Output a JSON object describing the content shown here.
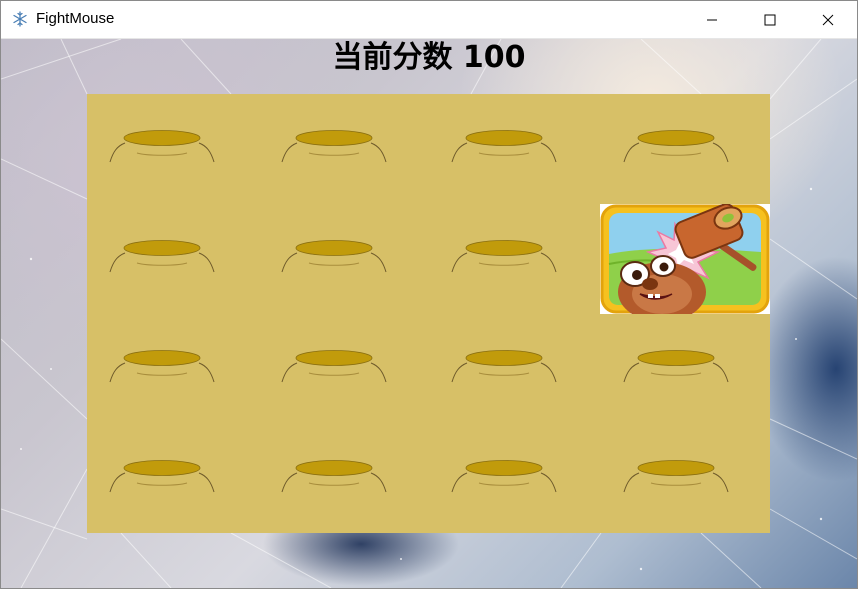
{
  "window": {
    "title": "FightMouse",
    "app_icon": "snowflake-icon",
    "controls": [
      "minimize-icon",
      "maximize-icon",
      "close-icon"
    ]
  },
  "game": {
    "score_text": "当前分数 100",
    "board_color": "#d7c067",
    "hole_color": "#c19b0b",
    "grid": {
      "rows": 4,
      "columns": 4
    },
    "mole_position": {
      "row": 2,
      "column": 4
    },
    "mole_icon": "mole-hammer-icon"
  }
}
